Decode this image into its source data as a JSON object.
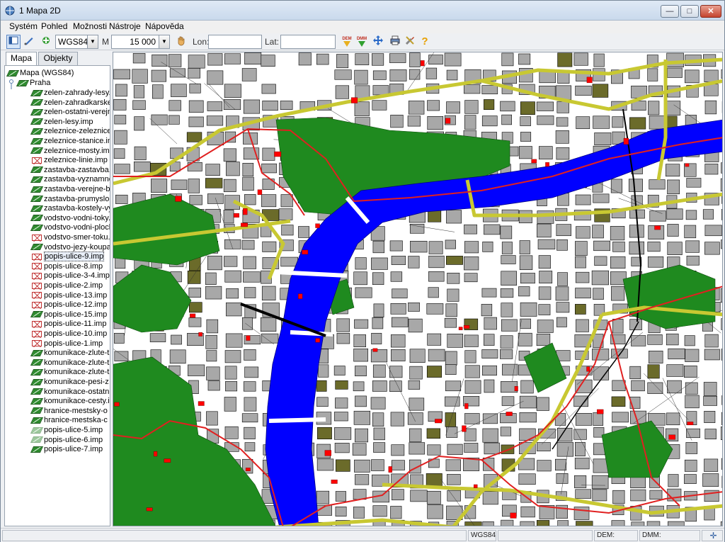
{
  "window": {
    "title": "1 Mapa 2D",
    "min_label": "—",
    "max_label": "□",
    "close_label": "✕"
  },
  "menu": {
    "items": [
      "Systém",
      "Pohled",
      "Možnosti",
      "Nástroje",
      "Nápověda"
    ]
  },
  "toolbar": {
    "projection": "WGS84",
    "scale_prefix": "M",
    "scale": "15 000",
    "lon_label": "Lon:",
    "lat_label": "Lat:",
    "lon_value": "",
    "lat_value": "",
    "dem_label": "DEM",
    "dmm_label": "DMM",
    "help_label": "?"
  },
  "tabs": [
    "Mapa",
    "Objekty"
  ],
  "tree": {
    "root": "Mapa (WGS84)",
    "group": "Praha",
    "layers": [
      {
        "name": "zelen-zahrady-lesy.",
        "state": "on"
      },
      {
        "name": "zelen-zahradkarske",
        "state": "on"
      },
      {
        "name": "zelen-ostatni-verejn",
        "state": "on"
      },
      {
        "name": "zelen-lesy.imp",
        "state": "on"
      },
      {
        "name": "zeleznice-zeleznice",
        "state": "on"
      },
      {
        "name": "zeleznice-stanice.in",
        "state": "on"
      },
      {
        "name": "zeleznice-mosty.im",
        "state": "on"
      },
      {
        "name": "zeleznice-linie.imp",
        "state": "off"
      },
      {
        "name": "zastavba-zastavba.",
        "state": "on"
      },
      {
        "name": "zastavba-vyznamne",
        "state": "on"
      },
      {
        "name": "zastavba-verejne-b",
        "state": "on"
      },
      {
        "name": "zastavba-prumyslo",
        "state": "on"
      },
      {
        "name": "zastavba-kostely-vy",
        "state": "on"
      },
      {
        "name": "vodstvo-vodni-toky.",
        "state": "on"
      },
      {
        "name": "vodstvo-vodni-ploch",
        "state": "on"
      },
      {
        "name": "vodstvo-smer-toku.",
        "state": "off"
      },
      {
        "name": "vodstvo-jezy-koupa",
        "state": "on"
      },
      {
        "name": "popis-ulice-9.imp",
        "state": "off",
        "selected": true
      },
      {
        "name": "popis-ulice-8.imp",
        "state": "off"
      },
      {
        "name": "popis-ulice-3-4.imp",
        "state": "off"
      },
      {
        "name": "popis-ulice-2.imp",
        "state": "off"
      },
      {
        "name": "popis-ulice-13.imp",
        "state": "off"
      },
      {
        "name": "popis-ulice-12.imp",
        "state": "off"
      },
      {
        "name": "popis-ulice-15.imp",
        "state": "on"
      },
      {
        "name": "popis-ulice-11.imp",
        "state": "off"
      },
      {
        "name": "popis-ulice-10.imp",
        "state": "off"
      },
      {
        "name": "popis-ulice-1.imp",
        "state": "off"
      },
      {
        "name": "komunikace-zlute-t",
        "state": "on"
      },
      {
        "name": "komunikace-zlute-t",
        "state": "on"
      },
      {
        "name": "komunikace-zlute-t",
        "state": "on"
      },
      {
        "name": "komunikace-pesi-z",
        "state": "on"
      },
      {
        "name": "komunikace-ostatn",
        "state": "on"
      },
      {
        "name": "komunikace-cesty.i",
        "state": "on"
      },
      {
        "name": "hranice-mestsky-o",
        "state": "on"
      },
      {
        "name": "hranice-mestska-c",
        "state": "on"
      },
      {
        "name": "popis-ulice-5.imp",
        "state": "dim"
      },
      {
        "name": "popis-ulice-6.imp",
        "state": "dim"
      },
      {
        "name": "popis-ulice-7.imp",
        "state": "on"
      }
    ]
  },
  "map": {
    "colors": {
      "water": "#0000ff",
      "green": "#1f8a1f",
      "built": "#a8a8a8",
      "road_major": "#c8c832",
      "boundary": "#e02020",
      "important": "#ff0000",
      "olive": "#6b6b2a",
      "rail": "#000000"
    }
  },
  "status": {
    "projection": "WGS84",
    "dem_label": "DEM:",
    "dmm_label": "DMM:"
  }
}
